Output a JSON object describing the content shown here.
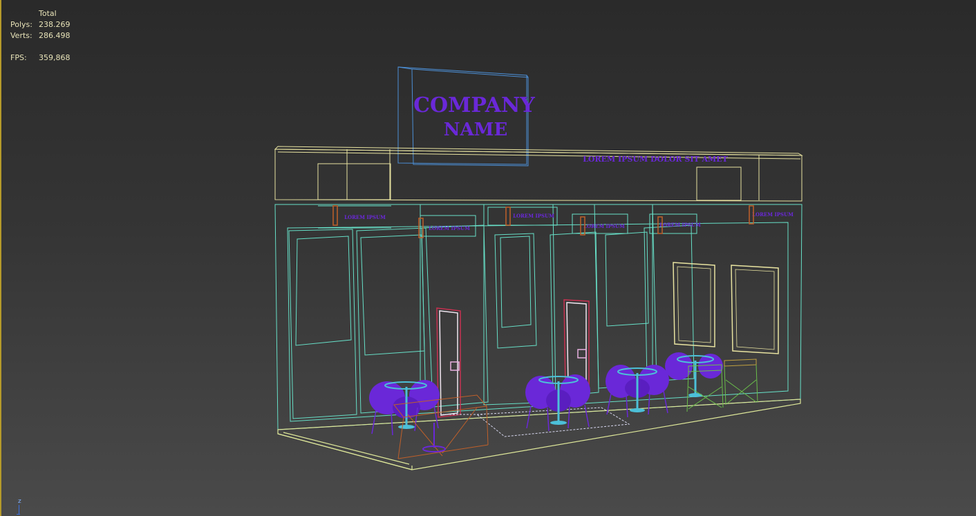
{
  "stats": {
    "header": "Total",
    "polys_label": "Polys:",
    "polys_value": "238.269",
    "verts_label": "Verts:",
    "verts_value": "286.498",
    "fps_label": "FPS:",
    "fps_value": "359,868"
  },
  "scene": {
    "sign_line1": "COMPANY",
    "sign_line2": "NAME",
    "header_text": "LOREM IPSUM DOLOR SIT AMET",
    "panel_labels": [
      "LOREM IPSUM",
      "LOREM IPSUM",
      "LOREM IPSUM",
      "LOREM IPSUM",
      "LOREM IPSUM",
      "LOREM IPSUM"
    ]
  },
  "axis": {
    "label": "z"
  },
  "colors": {
    "wire_cyan": "#67e0c8",
    "wire_yellow": "#e8e3a0",
    "wire_blue": "#4c8fd6",
    "purple": "#6a28d8",
    "door_red": "#c83050",
    "table_orange": "#c0602a",
    "stool_green": "#6abf4a",
    "stats_text": "#e8e3b8"
  }
}
